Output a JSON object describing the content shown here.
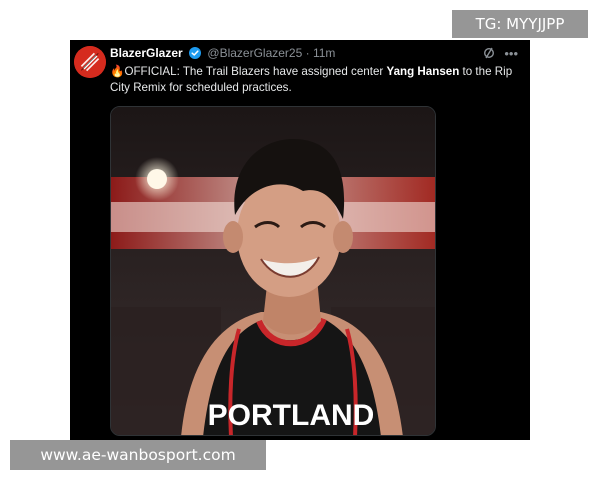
{
  "tweet": {
    "display_name": "BlazerGlazer",
    "handle": "@BlazerGlazer25",
    "separator": "·",
    "time": "11m",
    "emoji": "🔥",
    "text_before": "OFFICIAL: The Trail Blazers have assigned center ",
    "text_bold": "Yang Hansen",
    "text_after": " to the Rip City Remix for scheduled practices.",
    "more_icon": "ellipsis-icon",
    "refresh_icon": "grok-icon",
    "jersey_text": "PORTLAND"
  },
  "watermark": {
    "telegram": "TG: MYYJJPP",
    "site": "www.ae-wanbosport.com"
  },
  "colors": {
    "brand_red": "#d52b1e",
    "verified_blue": "#1d9bf0",
    "background": "#000000"
  }
}
